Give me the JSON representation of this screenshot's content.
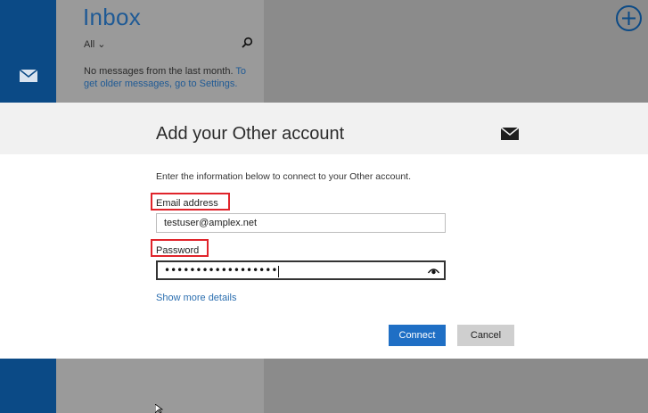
{
  "background": {
    "inbox_title": "Inbox",
    "filter_label": "All",
    "empty_message": "No messages from the last month.",
    "empty_link": "To get older messages, go to Settings."
  },
  "dialog": {
    "title": "Add your Other account",
    "instructions": "Enter the information below to connect to your Other account.",
    "email_label": "Email address",
    "email_value": "testuser@amplex.net",
    "password_label": "Password",
    "password_mask": "••••••••••••••••••",
    "show_more": "Show more details",
    "connect_label": "Connect",
    "cancel_label": "Cancel"
  },
  "colors": {
    "accent": "#0b4a86",
    "highlight": "#e0242b",
    "button_primary": "#1f6fc5"
  },
  "icons": [
    "mail-icon",
    "search-icon",
    "add-icon",
    "chevron-down-icon",
    "eye-icon",
    "cursor-icon"
  ]
}
